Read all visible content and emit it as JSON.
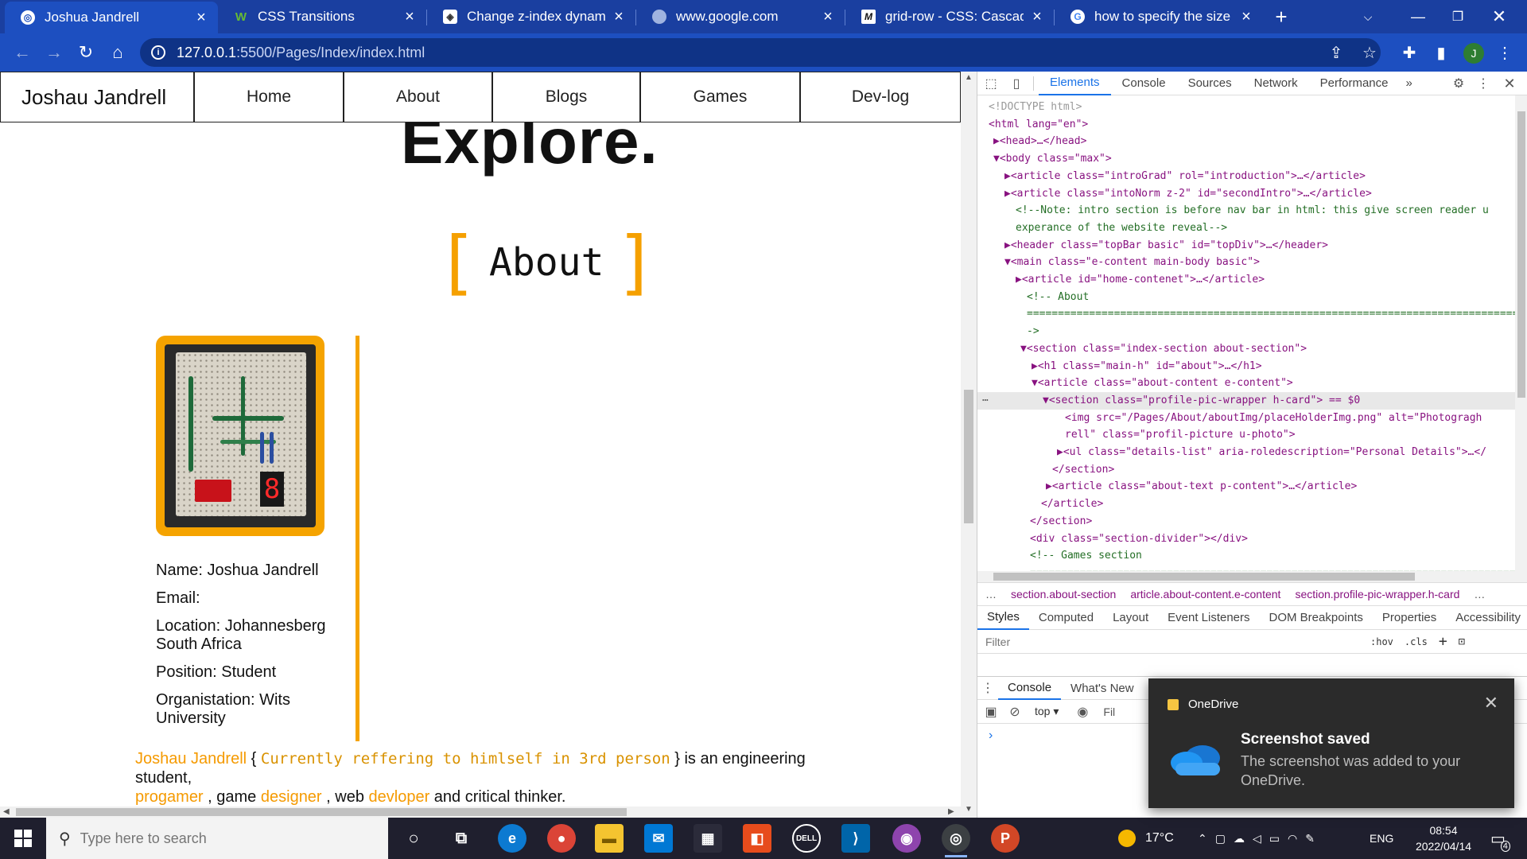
{
  "browser": {
    "tabs": [
      {
        "title": "Joshua Jandrell",
        "active": true
      },
      {
        "title": "CSS Transitions"
      },
      {
        "title": "Change z-index dynamically"
      },
      {
        "title": "www.google.com"
      },
      {
        "title": "grid-row - CSS: Cascading"
      },
      {
        "title": "how to specify the size of a"
      }
    ],
    "new_tab": "+",
    "url_host": "127.0.0.1",
    "url_path": ":5500/Pages/Index/index.html",
    "profile_initial": "J"
  },
  "page": {
    "brand": "Joshau Jandrell",
    "nav": [
      "Home",
      "About",
      "Blogs",
      "Games",
      "Dev-log"
    ],
    "explore_heading": "Explore.",
    "about": {
      "bracket_open": "[",
      "bracket_close": "]",
      "heading": "About",
      "details": [
        "Name: Joshua Jandrell",
        "Email:",
        "Location: Johannesberg South Africa",
        "Position: Student",
        "Organistation: Wits University"
      ],
      "text": {
        "name": "Joshau Jandrell",
        "aside_open": " { ",
        "aside": "Currently reffering to himlself in 3rd person",
        "aside_close": " } ",
        "part1": "is an engineering student,",
        "progamer": "progamer",
        "part2": " , game ",
        "designer": "designer",
        "part3": " , web ",
        "devloper": "devloper",
        "part4": " and critical thinker."
      },
      "photo_digit": "8"
    }
  },
  "devtools": {
    "tabs": [
      "Elements",
      "Console",
      "Sources",
      "Network",
      "Performance"
    ],
    "more": "»",
    "dom_lines": [
      "<!DOCTYPE html>",
      "<html lang=\"en\">",
      "▶<head>…</head>",
      "▼<body class=\"max\">",
      "▶<article class=\"introGrad\" rol=\"introduction\">…</article>",
      "▶<article class=\"intoNorm z-2\" id=\"secondIntro\">…</article>",
      "<!--Note: intro section is before nav bar in html: this give screen reader u",
      "experance of the website reveal-->",
      "▶<header class=\"topBar basic\" id=\"topDiv\">…</header>",
      "▼<main class=\"e-content main-body basic\">",
      "▶<article id=\"home-contenet\">…</article>",
      "<!-- About",
      "=================================================================================",
      "->",
      "▼<section class=\"index-section about-section\">",
      "▶<h1 class=\"main-h\" id=\"about\">…</h1>",
      "▼<article class=\"about-content e-content\">",
      "▼<section class=\"profile-pic-wrapper h-card\"> == $0",
      "<img src=\"/Pages/About/aboutImg/placeHolderImg.png\" alt=\"Photogragh",
      "rell\" class=\"profil-picture u-photo\">",
      "▶<ul class=\"details-list\" aria-roledescription=\"Personal Details\">…</",
      "</section>",
      "▶<article class=\"about-text p-content\">…</article>",
      "</article>",
      "</section>",
      "<div class=\"section-divider\"></div>",
      "<!-- Games section",
      "================================================================================="
    ],
    "breadcrumbs": [
      "…",
      "section.about-section",
      "article.about-content.e-content",
      "section.profile-pic-wrapper.h-card",
      "…"
    ],
    "style_tabs": [
      "Styles",
      "Computed",
      "Layout",
      "Event Listeners",
      "DOM Breakpoints",
      "Properties",
      "Accessibility"
    ],
    "filter_placeholder": "Filter",
    "hov": ":hov",
    "cls": ".cls",
    "drawer_tabs": [
      "Console",
      "What's New"
    ],
    "context": "top",
    "console_filter": "Fil",
    "prompt": "›"
  },
  "toast": {
    "app": "OneDrive",
    "title": "Screenshot saved",
    "body": "The screenshot was added to your OneDrive."
  },
  "taskbar": {
    "search_placeholder": "Type here to search",
    "temperature": "17°C",
    "language": "ENG",
    "time": "08:54",
    "date": "2022/04/14",
    "notifications": "4"
  }
}
